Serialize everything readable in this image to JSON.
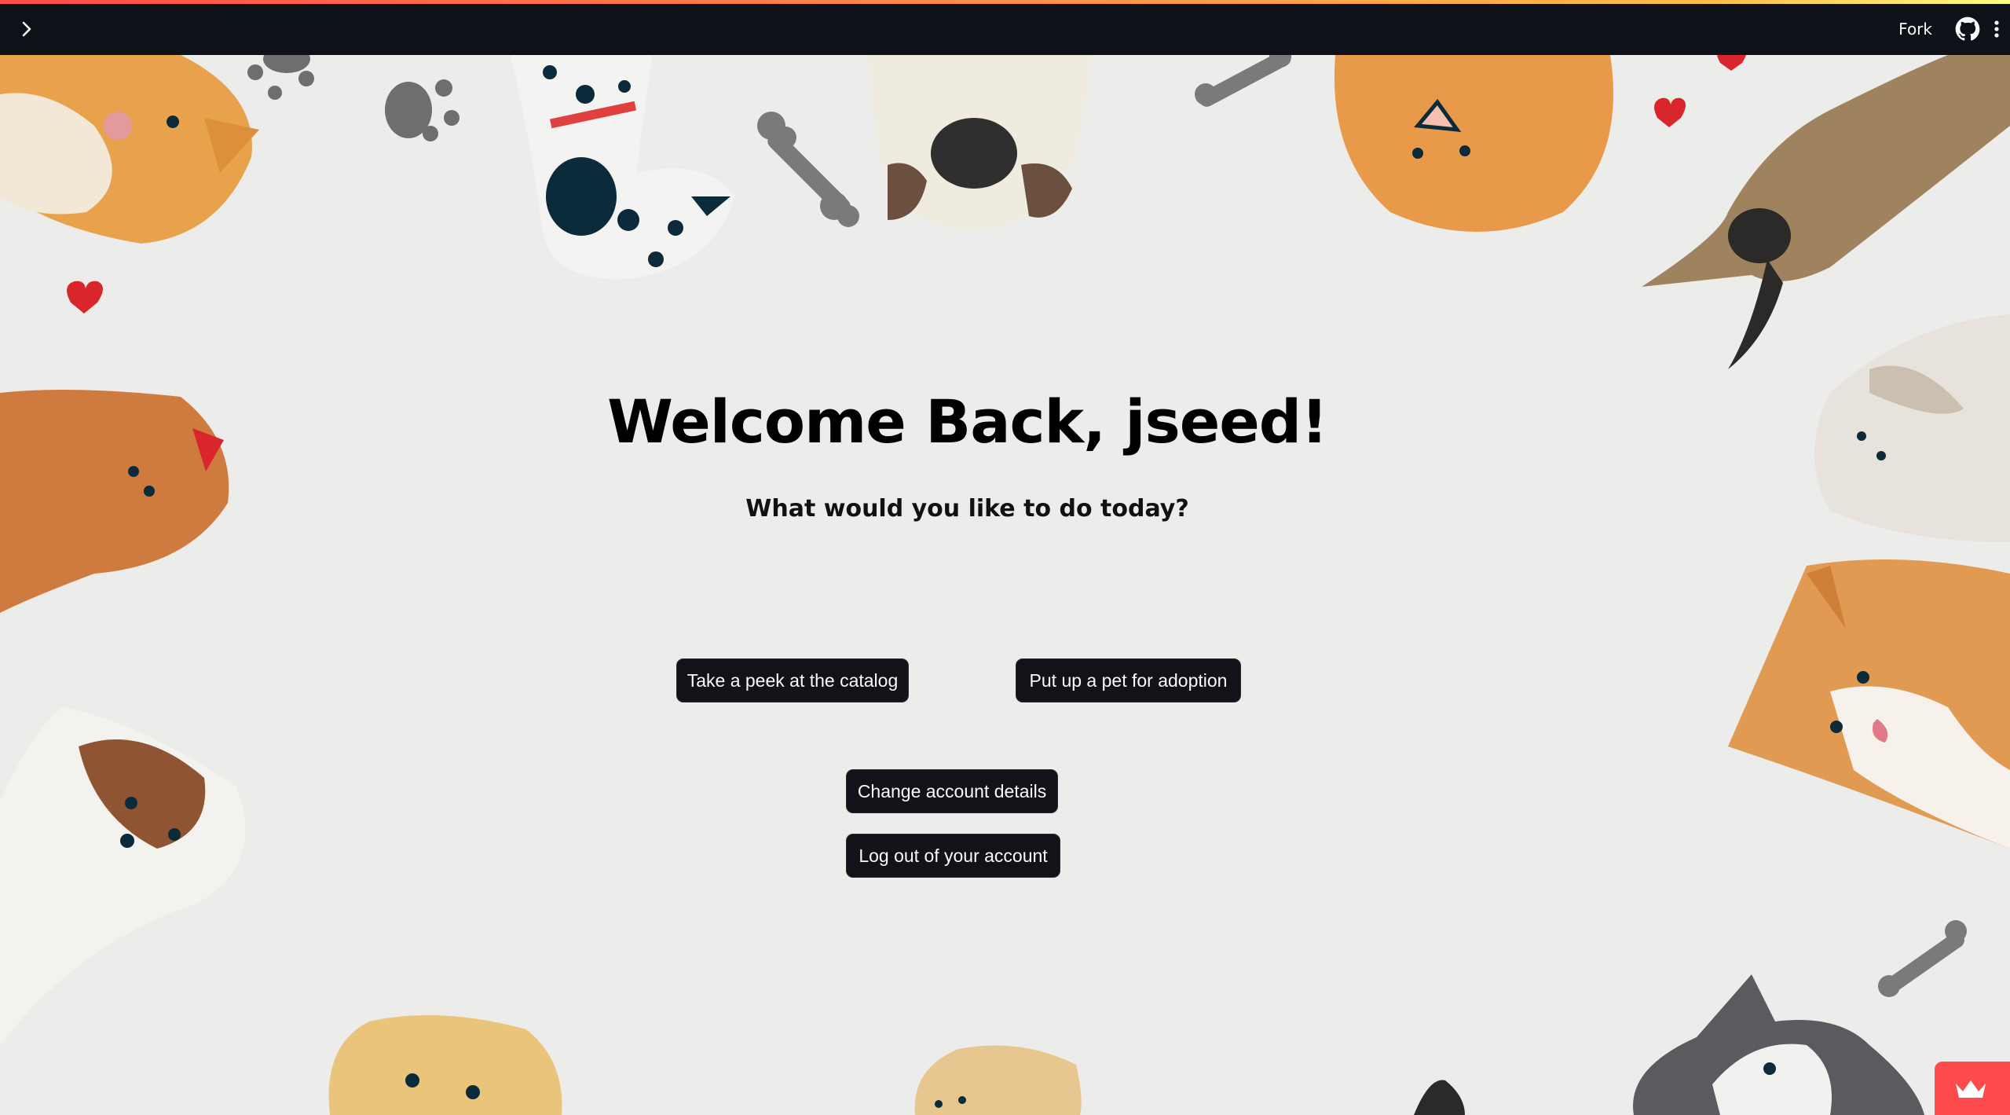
{
  "header": {
    "fork_label": "Fork",
    "icons": [
      "chevron-right-icon",
      "github-icon",
      "kebab-menu-icon"
    ]
  },
  "main": {
    "title": "Welcome Back, jseed!",
    "subtitle": "What would you like to do today?",
    "buttons": {
      "catalog": "Take a peek at the catalog",
      "adopt": "Put up a pet for adoption",
      "account": "Change account details",
      "logout": "Log out of your account"
    }
  },
  "colors": {
    "topbar": "#0e1117",
    "background": "#ececea",
    "button_bg": "#111318",
    "button_text": "#fafafa",
    "accent": "#ff4b4b"
  },
  "background_art": "dog-illustrations-pattern"
}
